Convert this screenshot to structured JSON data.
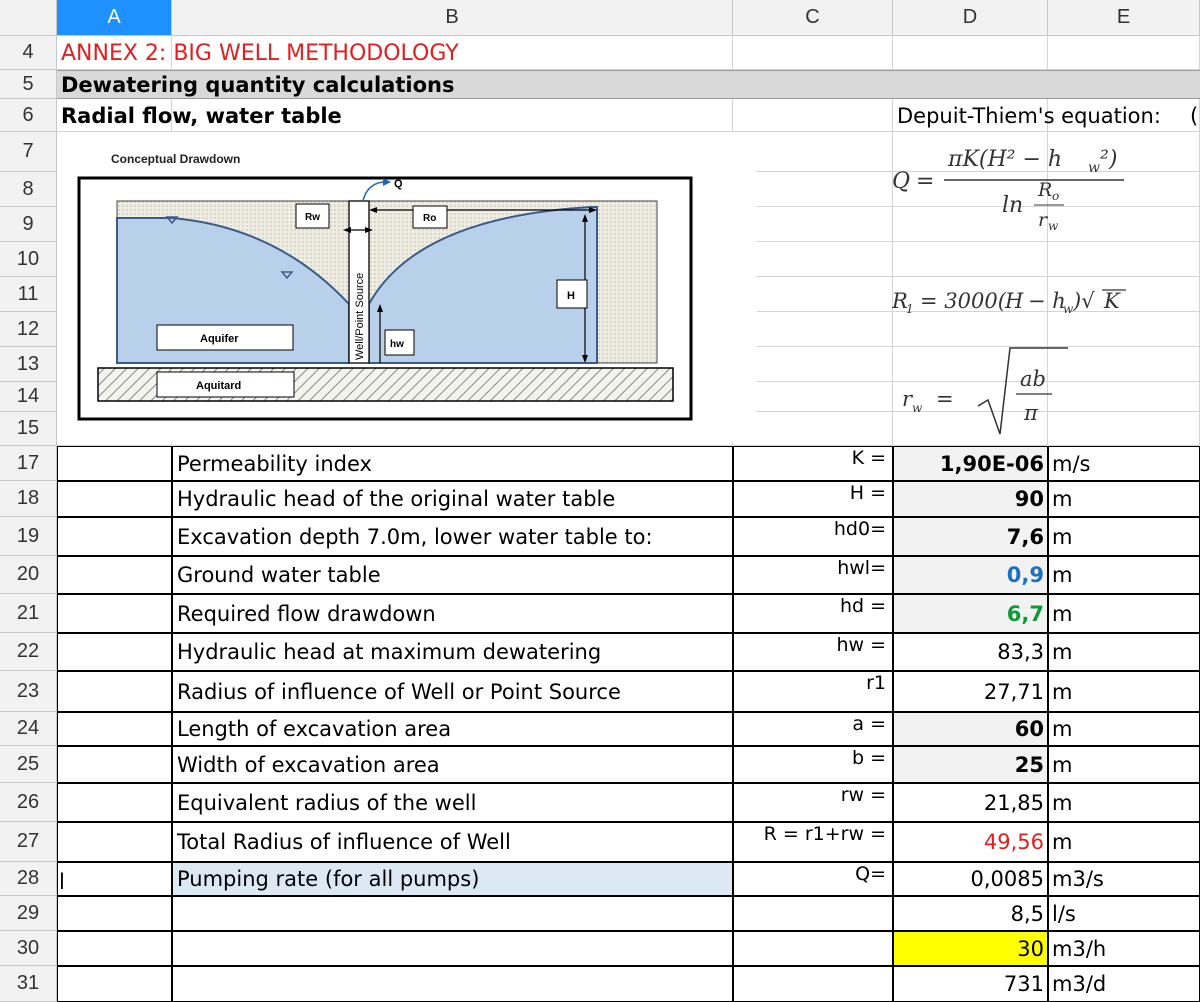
{
  "columns": [
    {
      "label": "A",
      "selected": true
    },
    {
      "label": "B",
      "selected": false
    },
    {
      "label": "C",
      "selected": false
    },
    {
      "label": "D",
      "selected": false
    },
    {
      "label": "E",
      "selected": false
    }
  ],
  "rows": [
    "4",
    "5",
    "6",
    "7",
    "8",
    "9",
    "10",
    "11",
    "12",
    "13",
    "14",
    "15",
    "17",
    "18",
    "19",
    "20",
    "21",
    "22",
    "23",
    "24",
    "25",
    "26",
    "27",
    "28",
    "29",
    "30",
    "31"
  ],
  "title": "ANNEX 2: BIG WELL METHODOLOGY",
  "section": "Dewatering quantity calculations",
  "subsection": "Radial flow, water table",
  "equation_heading": "Depuit-Thiem's equation:",
  "equation_cut": "(",
  "cell_a28": "l",
  "diagram": {
    "title": "Conceptual Drawdown",
    "q": "Q",
    "rw": "Rw",
    "ro": "Ro",
    "h": "H",
    "hw": "hw",
    "aquifer": "Aquifer",
    "aquitard": "Aquitard",
    "well": "Well/Point Source"
  },
  "params": [
    {
      "label": "Permeability index",
      "sym": "K =",
      "value": "1,90E-06",
      "unit": "m/s",
      "bold": true,
      "color": "#000000",
      "fill": "#f2f2f2"
    },
    {
      "label": "Hydraulic head of the original water table",
      "sym": "H =",
      "value": "90",
      "unit": "m",
      "bold": true,
      "color": "#000000",
      "fill": "#f2f2f2"
    },
    {
      "label": "Excavation depth 7.0m, lower water table to:",
      "sym": "hd0=",
      "value": "7,6",
      "unit": "m",
      "bold": true,
      "color": "#000000",
      "fill": "#f2f2f2"
    },
    {
      "label": "Ground water table",
      "sym": "hwl=",
      "value": "0,9",
      "unit": "m",
      "bold": true,
      "color": "#1f6fbf",
      "fill": "#f2f2f2"
    },
    {
      "label": "Required flow drawdown",
      "sym": "hd =",
      "value": "6,7",
      "unit": "m",
      "bold": true,
      "color": "#0f9a3a",
      "fill": "#f2f2f2"
    },
    {
      "label": "Hydraulic head at maximum dewatering",
      "sym": "hw =",
      "value": "83,3",
      "unit": "m",
      "bold": false,
      "color": "#000000",
      "fill": "#ffffff"
    },
    {
      "label": "Radius of influence of Well or Point Source",
      "sym": "r1",
      "value": "27,71",
      "unit": "m",
      "bold": false,
      "color": "#000000",
      "fill": "#ffffff"
    },
    {
      "label": "Length of excavation area",
      "sym": "a =",
      "value": "60",
      "unit": "m",
      "bold": true,
      "color": "#000000",
      "fill": "#f2f2f2"
    },
    {
      "label": "Width of excavation area",
      "sym": "b =",
      "value": "25",
      "unit": "m",
      "bold": true,
      "color": "#000000",
      "fill": "#f2f2f2"
    },
    {
      "label": "Equivalent radius of the well",
      "sym": "rw =",
      "value": "21,85",
      "unit": "m",
      "bold": false,
      "color": "#000000",
      "fill": "#ffffff"
    },
    {
      "label": "Total Radius of influence of Well",
      "sym": "R = r1+rw =",
      "value": "49,56",
      "unit": "m",
      "bold": false,
      "color": "#e02020",
      "fill": "#ffffff"
    },
    {
      "label": "Pumping rate (for all pumps)",
      "sym": "Q=",
      "value": "0,0085",
      "unit": "m3/s",
      "bold": false,
      "color": "#000000",
      "fill": "#ffffff"
    },
    {
      "label": "",
      "sym": "",
      "value": "8,5",
      "unit": "l/s",
      "bold": false,
      "color": "#000000",
      "fill": "#ffffff"
    },
    {
      "label": "",
      "sym": "",
      "value": "30",
      "unit": "m3/h",
      "bold": false,
      "color": "#000000",
      "fill": "#ffff00"
    },
    {
      "label": "",
      "sym": "",
      "value": "731",
      "unit": "m3/d",
      "bold": false,
      "color": "#000000",
      "fill": "#ffffff"
    }
  ],
  "colors": {
    "title": "#e02020",
    "section_fill": "#d9d9d9",
    "pumping_fill": "#dce9f5",
    "select": "#1e90ff",
    "water": "#b8d0ea",
    "sand": "#efece2"
  }
}
